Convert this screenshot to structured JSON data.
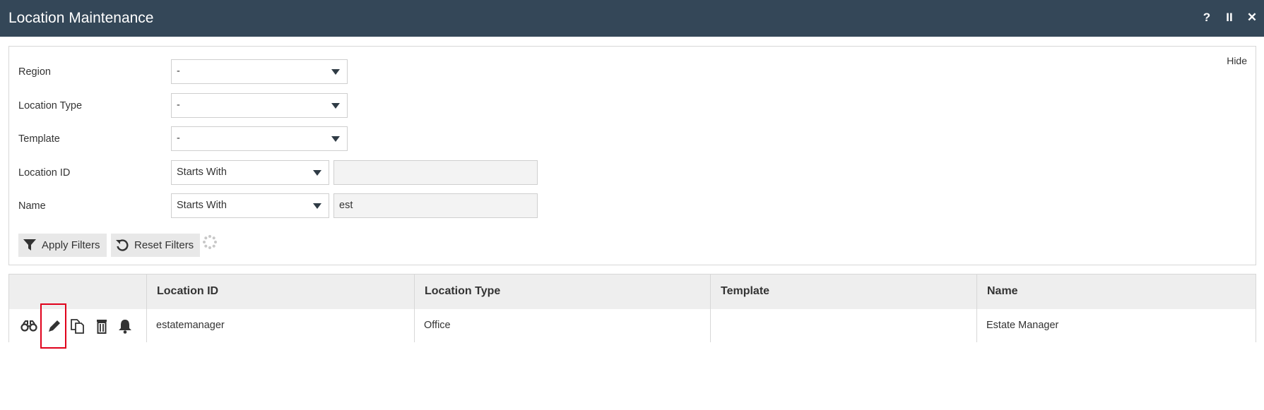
{
  "window": {
    "title": "Location Maintenance",
    "controls": [
      "?",
      "II",
      "✕"
    ]
  },
  "filters": {
    "hide_label": "Hide",
    "region": {
      "label": "Region",
      "value": "-"
    },
    "location_type": {
      "label": "Location Type",
      "value": "-"
    },
    "template": {
      "label": "Template",
      "value": "-"
    },
    "location_id": {
      "label": "Location ID",
      "operator": "Starts With",
      "value": ""
    },
    "name": {
      "label": "Name",
      "operator": "Starts With",
      "value": "est"
    },
    "apply_label": "Apply Filters",
    "reset_label": "Reset Filters"
  },
  "grid": {
    "columns": [
      "",
      "Location ID",
      "Location Type",
      "Template",
      "Name"
    ],
    "rows": [
      {
        "location_id": "estatemanager",
        "location_type": "Office",
        "template": "",
        "name": "Estate Manager"
      }
    ],
    "row_actions": [
      "view-binoculars-icon",
      "edit-pencil-icon",
      "copy-icon",
      "delete-trash-icon",
      "notify-bell-icon"
    ]
  },
  "colors": {
    "titlebar": "#344758",
    "highlight": "#e0001b"
  }
}
